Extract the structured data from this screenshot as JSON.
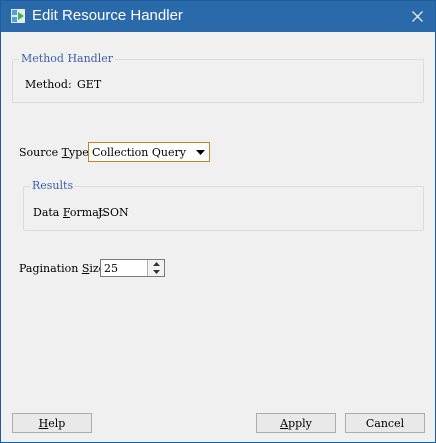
{
  "window": {
    "title": "Edit Resource Handler"
  },
  "method_handler": {
    "group_title": "Method Handler",
    "method_label": "Method:",
    "method_value": "GET"
  },
  "source_type": {
    "label_pre": "Source ",
    "label_access": "T",
    "label_post": "ype:",
    "selected": "Collection Query"
  },
  "results": {
    "group_title": "Results",
    "data_format_pre": "Data ",
    "data_format_access": "F",
    "data_format_post": "ormat:",
    "data_format_value": "JSON"
  },
  "pagination": {
    "label_pre": "Pagination ",
    "label_access": "S",
    "label_post": "ize:",
    "value": "25"
  },
  "buttons": {
    "help_access": "H",
    "help_rest": "elp",
    "apply_access": "A",
    "apply_rest": "pply",
    "cancel_label": "Cancel"
  },
  "icons": {
    "app": "resource-handler-icon",
    "close": "close-icon",
    "dropdown": "chevron-down-icon"
  },
  "colors": {
    "titlebar": "#2a6aab",
    "accent_border": "#c8841e",
    "group_title": "#3c5fa8"
  }
}
